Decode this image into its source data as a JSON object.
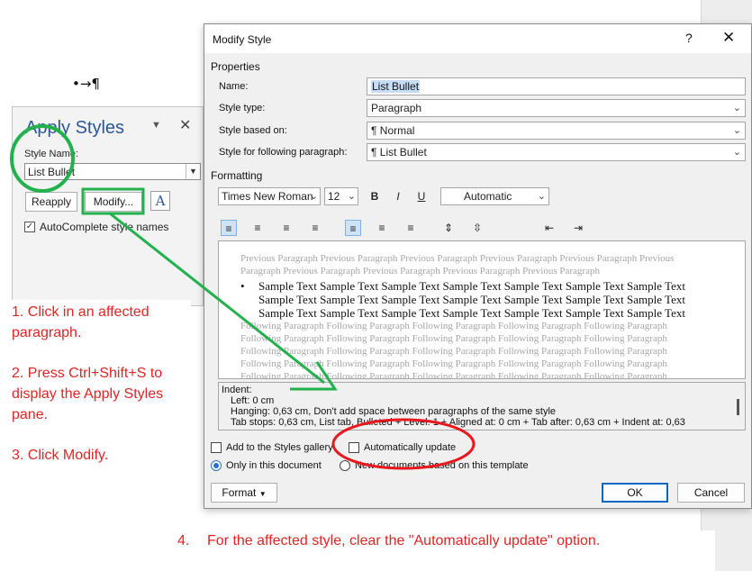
{
  "document": {
    "paragraph_mark": "•→¶"
  },
  "apply_styles": {
    "title": "Apply Styles",
    "style_name_label": "Style Name:",
    "style_name_value": "List Bullet",
    "reapply_label": "Reapply",
    "modify_label": "Modify...",
    "autocomplete_label": "AutoComplete style names",
    "autocomplete_checked": true
  },
  "instructions": {
    "step1": "1. Click in an affected paragraph.",
    "step2": "2. Press Ctrl+Shift+S to display the Apply Styles pane.",
    "step3": "3. Click Modify.",
    "step4_number": "4.",
    "step4_text": "For the affected style, clear the \"Automatically update\" option."
  },
  "dialog": {
    "title": "Modify Style",
    "help": "?",
    "properties_label": "Properties",
    "name_label": "Name:",
    "name_value": "List Bullet",
    "style_type_label": "Style type:",
    "style_type_value": "Paragraph",
    "style_based_on_label": "Style based on:",
    "style_based_on_value": "¶  Normal",
    "following_label": "Style for following paragraph:",
    "following_value": "¶  List Bullet",
    "formatting_label": "Formatting",
    "font_value": "Times New Roman",
    "size_value": "12",
    "bold": "B",
    "italic": "I",
    "underline": "U",
    "color_value": "Automatic",
    "preview": {
      "previous_line1": "Previous Paragraph Previous Paragraph Previous Paragraph Previous Paragraph Previous Paragraph Previous",
      "previous_line2": "Paragraph Previous Paragraph Previous Paragraph Previous Paragraph Previous Paragraph",
      "sample_lines": [
        "Sample Text Sample Text Sample Text Sample Text Sample Text Sample Text Sample Text",
        "Sample Text Sample Text Sample Text Sample Text Sample Text Sample Text Sample Text",
        "Sample Text Sample Text Sample Text Sample Text Sample Text Sample Text Sample Text"
      ],
      "following_lines": [
        "Following Paragraph Following Paragraph Following Paragraph Following Paragraph Following Paragraph",
        "Following Paragraph Following Paragraph Following Paragraph Following Paragraph Following Paragraph",
        "Following Paragraph Following Paragraph Following Paragraph Following Paragraph Following Paragraph",
        "Following Paragraph Following Paragraph Following Paragraph Following Paragraph Following Paragraph",
        "Following Paragraph Following Paragraph Following Paragraph Following Paragraph Following Paragraph"
      ]
    },
    "description": {
      "line1": "Indent:",
      "line2": "Left:  0 cm",
      "line3": "Hanging:  0,63 cm, Don't add space between paragraphs of the same style",
      "line4": "Tab stops:  0,63 cm, List tab, Bulleted + Level: 1 + Aligned at:  0 cm + Tab after:  0,63 cm + Indent at:  0,63"
    },
    "add_to_gallery_label": "Add to the Styles gallery",
    "add_to_gallery_checked": false,
    "auto_update_label": "Automatically update",
    "auto_update_checked": false,
    "only_this_doc_label": "Only in this document",
    "new_docs_label": "New documents based on this template",
    "format_label": "Format",
    "ok_label": "OK",
    "cancel_label": "Cancel"
  },
  "annotation_colors": {
    "green": "#22b14c",
    "red": "#e8181e",
    "instruction_text": "#e02424"
  }
}
